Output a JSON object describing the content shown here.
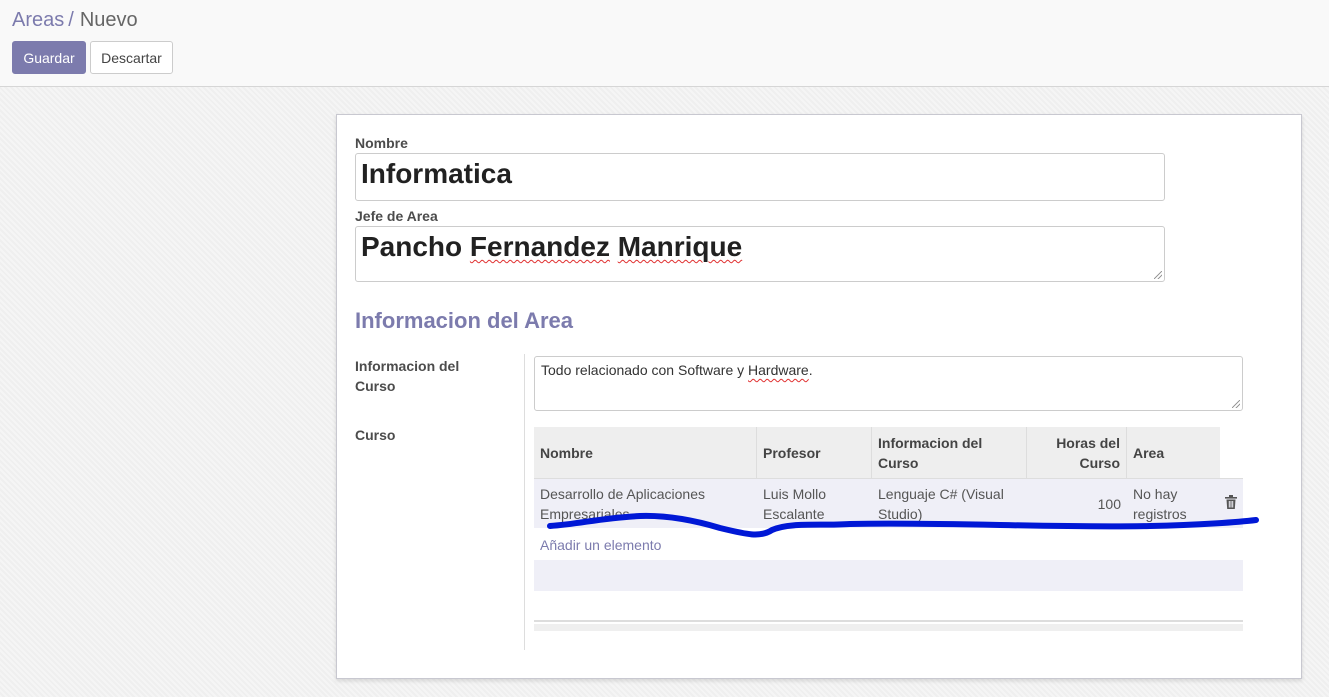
{
  "breadcrumb": {
    "parent": "Areas",
    "separator": "/",
    "current": "Nuevo"
  },
  "toolbar": {
    "save_label": "Guardar",
    "discard_label": "Descartar"
  },
  "form": {
    "nombre_label": "Nombre",
    "nombre_value": "Informatica",
    "jefe_label": "Jefe de Area",
    "jefe_first": "Pancho",
    "jefe_second": "Fernandez",
    "jefe_third": "Manrique",
    "section_title": "Informacion del Area",
    "info_label": "Informacion del Curso",
    "info_value_a": "Todo relacionado con Software y",
    "info_value_b": "Hardware",
    "info_value_c": ".",
    "curso_label": "Curso"
  },
  "table": {
    "headers": {
      "nombre": "Nombre",
      "profesor": "Profesor",
      "informacion": "Informacion del Curso",
      "horas": "Horas del Curso",
      "area": "Area"
    },
    "rows": [
      {
        "nombre": "Desarrollo de Aplicaciones Empresariales",
        "profesor": "Luis Mollo Escalante",
        "informacion": "Lenguaje C# (Visual Studio)",
        "horas": "100",
        "area": "No hay registros"
      }
    ],
    "add_label": "Añadir un elemento"
  },
  "colors": {
    "accent": "#7c7bad",
    "annotation": "#0018d6"
  },
  "icons": {
    "delete": "trash-icon"
  }
}
